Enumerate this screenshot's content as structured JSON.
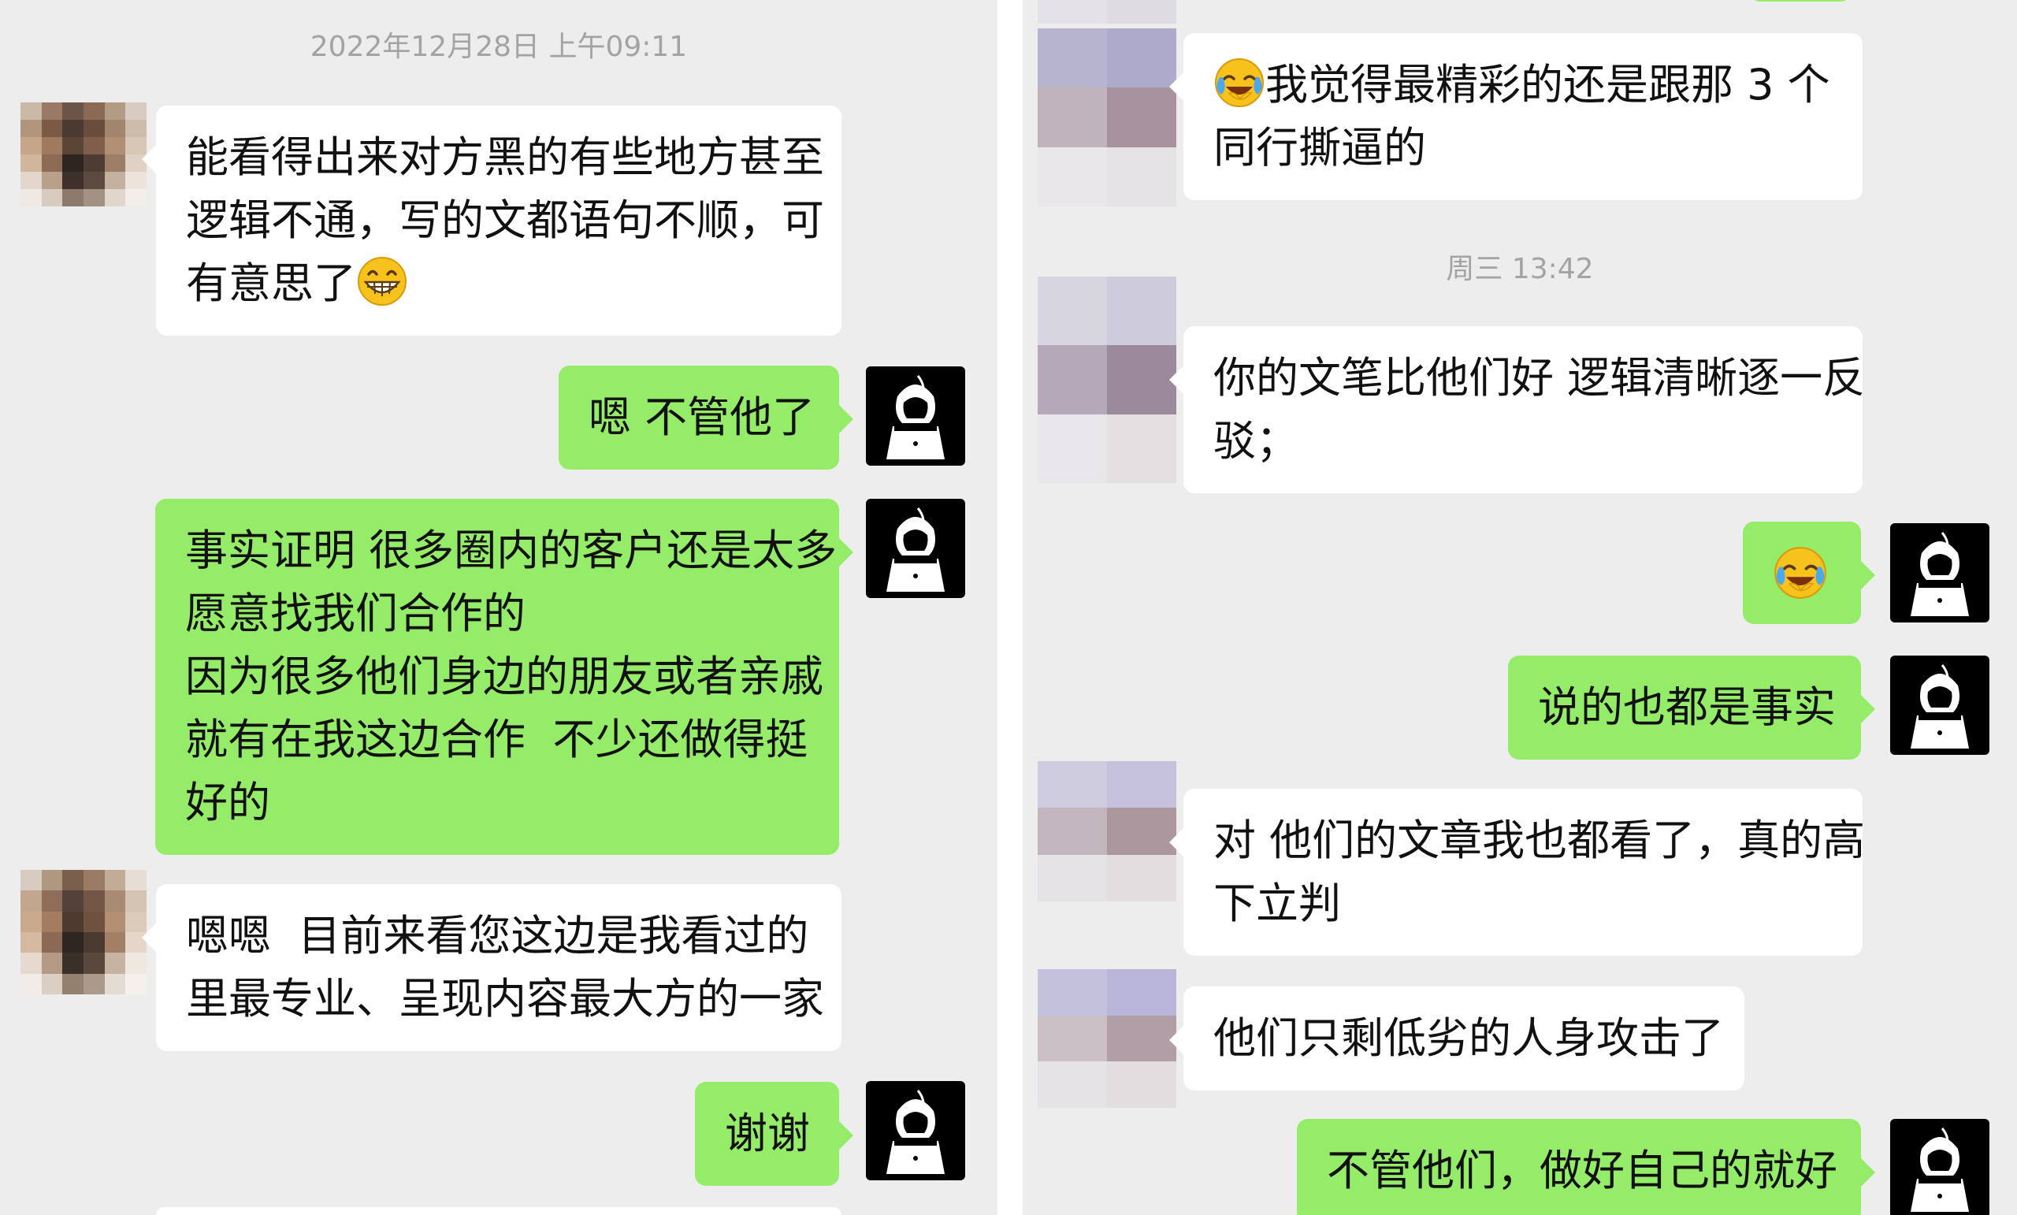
{
  "left": {
    "timestamp": "2022年12月28日 上午09:11",
    "messages": [
      {
        "lines": [
          "能看得出来对方黑的有些地方甚至",
          "逻辑不通，写的文都语句不顺，可",
          "有意思了"
        ],
        "emoji": "grin-emoji"
      },
      {
        "lines": [
          "嗯 不管他了"
        ]
      },
      {
        "lines": [
          "事实证明 很多圈内的客户还是太多",
          "愿意找我们合作的",
          "因为很多他们身边的朋友或者亲戚",
          "就有在我这边合作  不少还做得挺",
          "好的"
        ]
      },
      {
        "lines": [
          "嗯嗯  目前来看您这边是我看过的",
          "里最专业、呈现内容最大方的一家"
        ]
      },
      {
        "lines": [
          "谢谢"
        ]
      }
    ]
  },
  "right": {
    "timestamp": "周三 13:42",
    "messages": [
      {
        "lines": [
          "我觉得最精彩的还是跟那 3 个",
          "同行撕逼的"
        ],
        "emoji": "laugh-cry-emoji"
      },
      {
        "lines": [
          "你的文笔比他们好 逻辑清晰逐一反",
          "驳；"
        ]
      },
      {
        "lines": [
          ""
        ],
        "emoji": "laugh-cry-emoji"
      },
      {
        "lines": [
          "说的也都是事实"
        ]
      },
      {
        "lines": [
          "对 他们的文章我也都看了，真的高",
          "下立判"
        ]
      },
      {
        "lines": [
          "他们只剩低劣的人身攻击了"
        ]
      },
      {
        "lines": [
          "不管他们，做好自己的就好"
        ]
      }
    ]
  },
  "colors": {
    "background": "#ededed",
    "bubble_in": "#ffffff",
    "bubble_out": "#95ec69",
    "timestamp": "#a3a3a3"
  }
}
